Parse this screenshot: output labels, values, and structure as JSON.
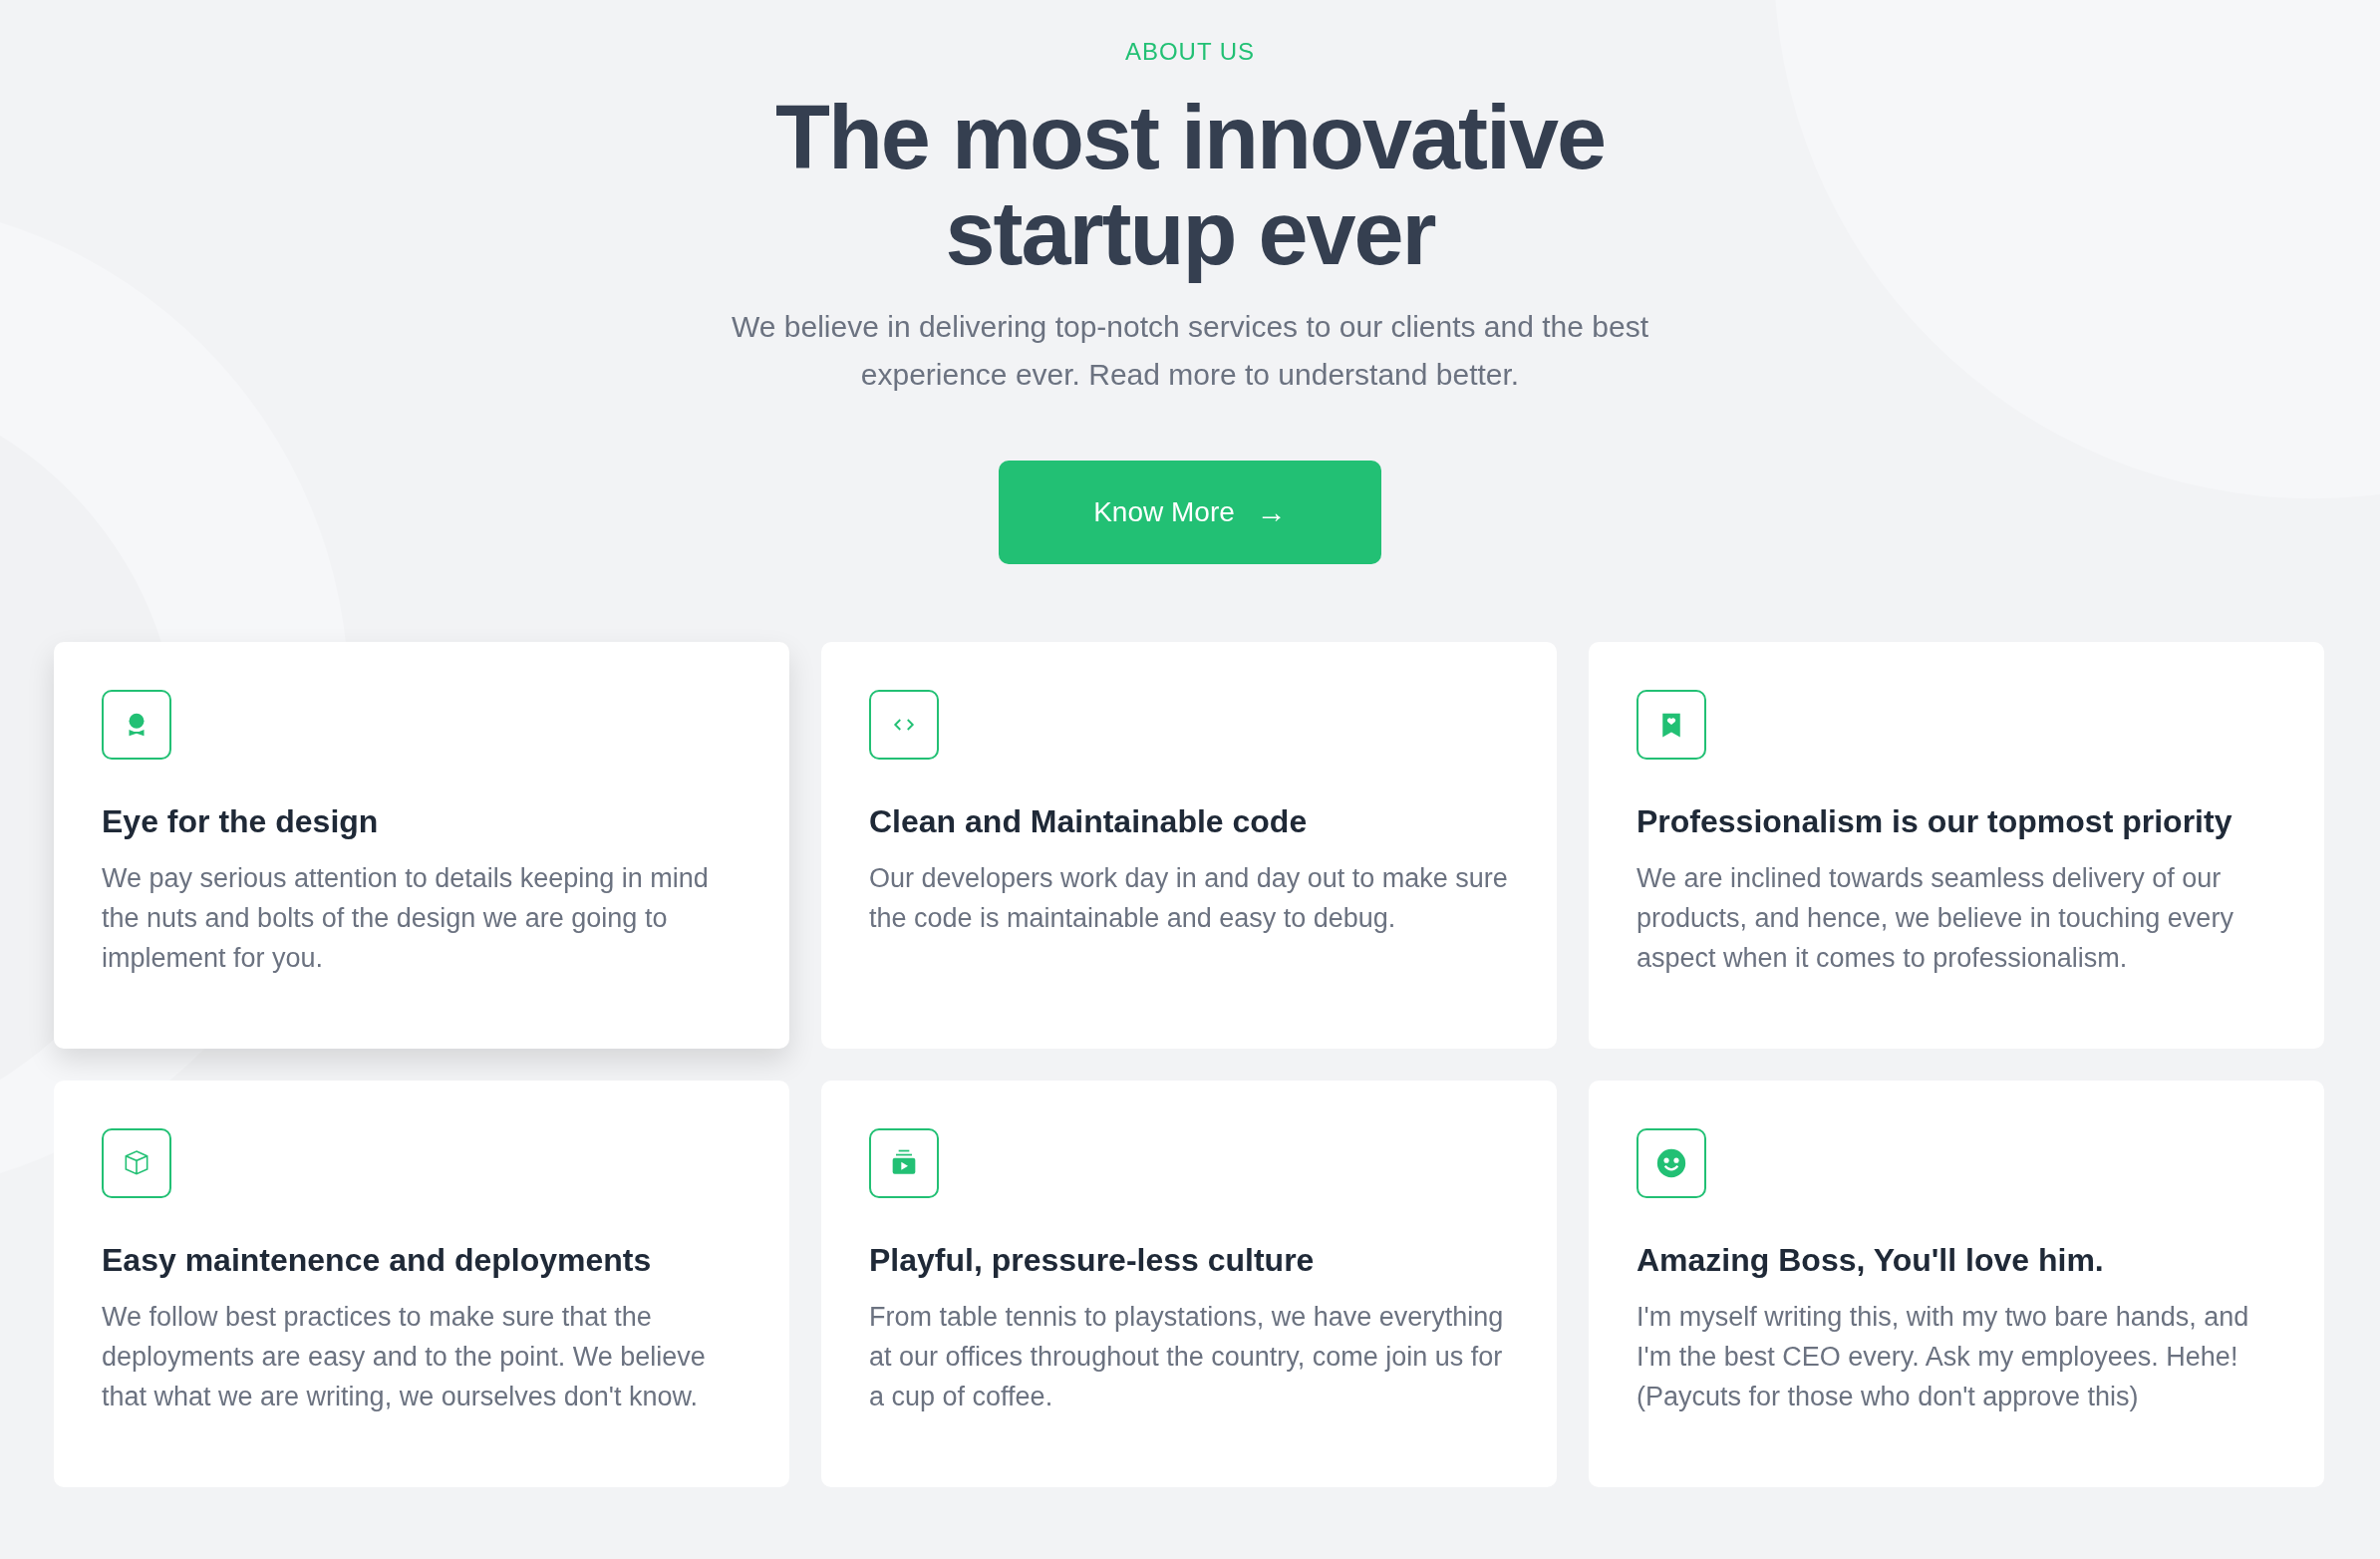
{
  "eyebrow": "ABOUT US",
  "title": "The most innovative startup ever",
  "subtitle": "We believe in delivering top-notch services to our clients and the best experience ever. Read more to understand better.",
  "button": {
    "label": "Know More",
    "arrow": "→"
  },
  "cards": [
    {
      "title": "Eye for the design",
      "text": "We pay serious attention to details keeping in mind the nuts and bolts of the design we are going to implement for you.",
      "highlighted": true
    },
    {
      "title": "Clean and Maintainable code",
      "text": "Our developers work day in and day out to make sure the code is maintainable and easy to debug.",
      "highlighted": false
    },
    {
      "title": "Professionalism is our topmost priority",
      "text": "We are inclined towards seamless delivery of our products, and hence, we believe in touching every aspect when it comes to professionalism.",
      "highlighted": false
    },
    {
      "title": "Easy maintenence and deployments",
      "text": "We follow best practices to make sure that the deployments are easy and to the point. We believe that what we are writing, we ourselves don't know.",
      "highlighted": false
    },
    {
      "title": "Playful, pressure-less culture",
      "text": "From table tennis to playstations, we have everything at our offices throughout the country, come join us for a cup of coffee.",
      "highlighted": false
    },
    {
      "title": "Amazing Boss, You'll love him.",
      "text": "I'm myself writing this, with my two bare hands, and I'm the best CEO every. Ask my employees. Hehe! (Paycuts for those who don't approve this)",
      "highlighted": false
    }
  ]
}
